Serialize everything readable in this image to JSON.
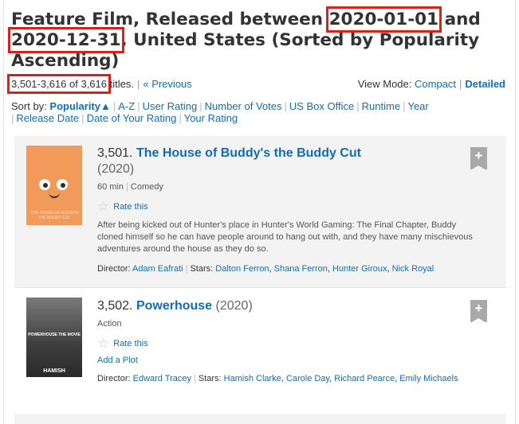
{
  "header": {
    "title_part1": "Feature Film, Released between ",
    "date_from": "2020-01-01",
    "title_part2": " and ",
    "date_to": "2020-12-31",
    "title_part3": ", United States (Sorted by Popularity Ascending)"
  },
  "results": {
    "count": "3,501-3,616 of 3,616",
    "titles_suffix": "titles.",
    "previous_label": "« Previous",
    "view_mode_label": "View Mode:",
    "compact_label": "Compact",
    "detailed_label": "Detailed"
  },
  "sort": {
    "label": "Sort by:",
    "current": "Popularity",
    "current_arrow": "▲",
    "options": [
      "A-Z",
      "User Rating",
      "Number of Votes",
      "US Box Office",
      "Runtime",
      "Year",
      "Release Date",
      "Date of Your Rating",
      "Your Rating"
    ]
  },
  "items": [
    {
      "index": "3,501.",
      "title": "The House of Buddy's the Buddy Cut",
      "year": "(2020)",
      "runtime": "60 min",
      "genre": "Comedy",
      "rate_label": "Rate this",
      "plot": "After being kicked out of Hunter's place in Hunter's World Gaming: The Final Chapter, Buddy cloned himself so he can have people around to hang out with, and they have many mischievous adventures around the house as they do so.",
      "director_label": "Director:",
      "director": "Adam Eafrati",
      "stars_label": "Stars:",
      "stars": [
        "Dalton Ferron",
        "Shana Ferron",
        "Hunter Giroux",
        "Nick Royal"
      ],
      "poster_text": "THE HOUSE OF BUDDYS THE BUDDY CUT",
      "add_label": "+"
    },
    {
      "index": "3,502.",
      "title": "Powerhouse",
      "year": "(2020)",
      "genre": "Action",
      "rate_label": "Rate this",
      "add_plot_label": "Add a Plot",
      "director_label": "Director:",
      "director": "Edward Tracey",
      "stars_label": "Stars:",
      "stars": [
        "Hamish Clarke",
        "Carole Day",
        "Richard Pearce",
        "Emily Michaels"
      ],
      "poster_title": "POWERHOUSE THE MOVIE",
      "poster_name": "HAMISH",
      "add_label": "+"
    }
  ],
  "colors": {
    "link": "#136cb2",
    "highlight_box": "#d9211b",
    "row_bg": "#f3f3f3"
  }
}
